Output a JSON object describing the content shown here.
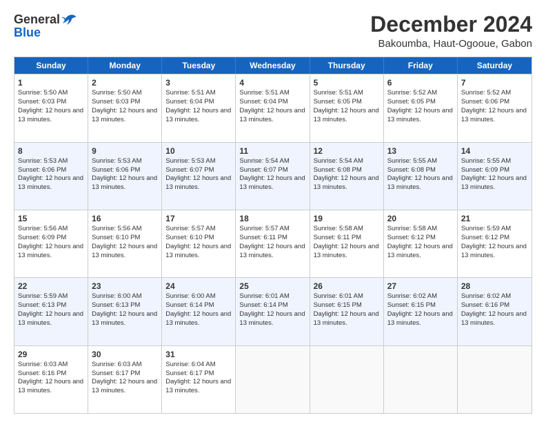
{
  "logo": {
    "general": "General",
    "blue": "Blue"
  },
  "header": {
    "title": "December 2024",
    "subtitle": "Bakoumba, Haut-Ogooue, Gabon"
  },
  "days_of_week": [
    "Sunday",
    "Monday",
    "Tuesday",
    "Wednesday",
    "Thursday",
    "Friday",
    "Saturday"
  ],
  "weeks": [
    [
      {
        "day": "1",
        "sunrise": "Sunrise: 5:50 AM",
        "sunset": "Sunset: 6:03 PM",
        "daylight": "Daylight: 12 hours and 13 minutes."
      },
      {
        "day": "2",
        "sunrise": "Sunrise: 5:50 AM",
        "sunset": "Sunset: 6:03 PM",
        "daylight": "Daylight: 12 hours and 13 minutes."
      },
      {
        "day": "3",
        "sunrise": "Sunrise: 5:51 AM",
        "sunset": "Sunset: 6:04 PM",
        "daylight": "Daylight: 12 hours and 13 minutes."
      },
      {
        "day": "4",
        "sunrise": "Sunrise: 5:51 AM",
        "sunset": "Sunset: 6:04 PM",
        "daylight": "Daylight: 12 hours and 13 minutes."
      },
      {
        "day": "5",
        "sunrise": "Sunrise: 5:51 AM",
        "sunset": "Sunset: 6:05 PM",
        "daylight": "Daylight: 12 hours and 13 minutes."
      },
      {
        "day": "6",
        "sunrise": "Sunrise: 5:52 AM",
        "sunset": "Sunset: 6:05 PM",
        "daylight": "Daylight: 12 hours and 13 minutes."
      },
      {
        "day": "7",
        "sunrise": "Sunrise: 5:52 AM",
        "sunset": "Sunset: 6:06 PM",
        "daylight": "Daylight: 12 hours and 13 minutes."
      }
    ],
    [
      {
        "day": "8",
        "sunrise": "Sunrise: 5:53 AM",
        "sunset": "Sunset: 6:06 PM",
        "daylight": "Daylight: 12 hours and 13 minutes."
      },
      {
        "day": "9",
        "sunrise": "Sunrise: 5:53 AM",
        "sunset": "Sunset: 6:06 PM",
        "daylight": "Daylight: 12 hours and 13 minutes."
      },
      {
        "day": "10",
        "sunrise": "Sunrise: 5:53 AM",
        "sunset": "Sunset: 6:07 PM",
        "daylight": "Daylight: 12 hours and 13 minutes."
      },
      {
        "day": "11",
        "sunrise": "Sunrise: 5:54 AM",
        "sunset": "Sunset: 6:07 PM",
        "daylight": "Daylight: 12 hours and 13 minutes."
      },
      {
        "day": "12",
        "sunrise": "Sunrise: 5:54 AM",
        "sunset": "Sunset: 6:08 PM",
        "daylight": "Daylight: 12 hours and 13 minutes."
      },
      {
        "day": "13",
        "sunrise": "Sunrise: 5:55 AM",
        "sunset": "Sunset: 6:08 PM",
        "daylight": "Daylight: 12 hours and 13 minutes."
      },
      {
        "day": "14",
        "sunrise": "Sunrise: 5:55 AM",
        "sunset": "Sunset: 6:09 PM",
        "daylight": "Daylight: 12 hours and 13 minutes."
      }
    ],
    [
      {
        "day": "15",
        "sunrise": "Sunrise: 5:56 AM",
        "sunset": "Sunset: 6:09 PM",
        "daylight": "Daylight: 12 hours and 13 minutes."
      },
      {
        "day": "16",
        "sunrise": "Sunrise: 5:56 AM",
        "sunset": "Sunset: 6:10 PM",
        "daylight": "Daylight: 12 hours and 13 minutes."
      },
      {
        "day": "17",
        "sunrise": "Sunrise: 5:57 AM",
        "sunset": "Sunset: 6:10 PM",
        "daylight": "Daylight: 12 hours and 13 minutes."
      },
      {
        "day": "18",
        "sunrise": "Sunrise: 5:57 AM",
        "sunset": "Sunset: 6:11 PM",
        "daylight": "Daylight: 12 hours and 13 minutes."
      },
      {
        "day": "19",
        "sunrise": "Sunrise: 5:58 AM",
        "sunset": "Sunset: 6:11 PM",
        "daylight": "Daylight: 12 hours and 13 minutes."
      },
      {
        "day": "20",
        "sunrise": "Sunrise: 5:58 AM",
        "sunset": "Sunset: 6:12 PM",
        "daylight": "Daylight: 12 hours and 13 minutes."
      },
      {
        "day": "21",
        "sunrise": "Sunrise: 5:59 AM",
        "sunset": "Sunset: 6:12 PM",
        "daylight": "Daylight: 12 hours and 13 minutes."
      }
    ],
    [
      {
        "day": "22",
        "sunrise": "Sunrise: 5:59 AM",
        "sunset": "Sunset: 6:13 PM",
        "daylight": "Daylight: 12 hours and 13 minutes."
      },
      {
        "day": "23",
        "sunrise": "Sunrise: 6:00 AM",
        "sunset": "Sunset: 6:13 PM",
        "daylight": "Daylight: 12 hours and 13 minutes."
      },
      {
        "day": "24",
        "sunrise": "Sunrise: 6:00 AM",
        "sunset": "Sunset: 6:14 PM",
        "daylight": "Daylight: 12 hours and 13 minutes."
      },
      {
        "day": "25",
        "sunrise": "Sunrise: 6:01 AM",
        "sunset": "Sunset: 6:14 PM",
        "daylight": "Daylight: 12 hours and 13 minutes."
      },
      {
        "day": "26",
        "sunrise": "Sunrise: 6:01 AM",
        "sunset": "Sunset: 6:15 PM",
        "daylight": "Daylight: 12 hours and 13 minutes."
      },
      {
        "day": "27",
        "sunrise": "Sunrise: 6:02 AM",
        "sunset": "Sunset: 6:15 PM",
        "daylight": "Daylight: 12 hours and 13 minutes."
      },
      {
        "day": "28",
        "sunrise": "Sunrise: 6:02 AM",
        "sunset": "Sunset: 6:16 PM",
        "daylight": "Daylight: 12 hours and 13 minutes."
      }
    ],
    [
      {
        "day": "29",
        "sunrise": "Sunrise: 6:03 AM",
        "sunset": "Sunset: 6:16 PM",
        "daylight": "Daylight: 12 hours and 13 minutes."
      },
      {
        "day": "30",
        "sunrise": "Sunrise: 6:03 AM",
        "sunset": "Sunset: 6:17 PM",
        "daylight": "Daylight: 12 hours and 13 minutes."
      },
      {
        "day": "31",
        "sunrise": "Sunrise: 6:04 AM",
        "sunset": "Sunset: 6:17 PM",
        "daylight": "Daylight: 12 hours and 13 minutes."
      },
      null,
      null,
      null,
      null
    ]
  ]
}
